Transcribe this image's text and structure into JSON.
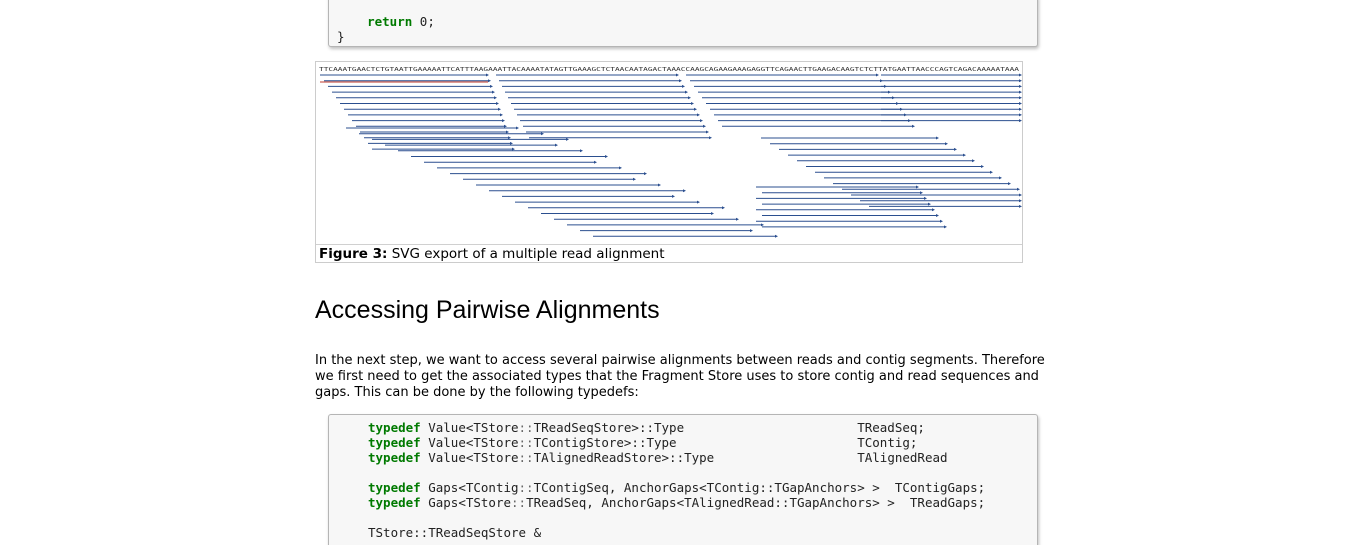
{
  "top_code": {
    "line1_kw": "return",
    "line1_rest": " 0;",
    "line2": "}"
  },
  "figure": {
    "caption_label": "Figure 3:",
    "caption_text": "SVG export of a multiple read alignment",
    "sequence": "TTCAAATGAACTCTGTAATTGAAAAATTCATTTAAGAAATTACAAAATATAGTTGAAAGCTCTAACAATAGACTAAACCAAGCAGAAGAAAGAGGTTCAGAACTTGAAGACAAGTCTCTTATGAATTAACCCAGTCAGACAAAAATAAA",
    "colors": {
      "read": "#2b4f8f",
      "ref": "#c0392b"
    }
  },
  "section": {
    "title": "Accessing Pairwise Alignments",
    "paragraph": "In the next step, we want to access several pairwise alignments between reads and contig segments. Therefore we first need to get the associated types that the Fragment Store uses to store contig and read sequences and gaps. This can be done by the following typedefs:"
  },
  "bottom_code": {
    "lines": [
      {
        "kw": "typedef",
        "pre": " Value<TStore",
        "ns": "::",
        "post": "TReadSeqStore>::Type",
        "name": "TReadSeq;"
      },
      {
        "kw": "typedef",
        "pre": " Value<TStore",
        "ns": "::",
        "post": "TContigStore>::Type",
        "name": "TContig;"
      },
      {
        "kw": "typedef",
        "pre": " Value<TStore",
        "ns": "::",
        "post": "TAlignedReadStore>::Type",
        "name": "TAlignedRead"
      },
      {
        "kw": "typedef",
        "pre": " Gaps<TContig",
        "ns": "::",
        "post": "TContigSeq, AnchorGaps<TContig::TGapAnchors> >",
        "name": "TContigGaps;"
      },
      {
        "kw": "typedef",
        "pre": " Gaps<TStore",
        "ns": "::",
        "post": "TReadSeq, AnchorGaps<TAlignedRead::TGapAnchors> >",
        "name": "TReadGaps;"
      }
    ],
    "last_partial": "TStore::TReadSeqStore &"
  }
}
